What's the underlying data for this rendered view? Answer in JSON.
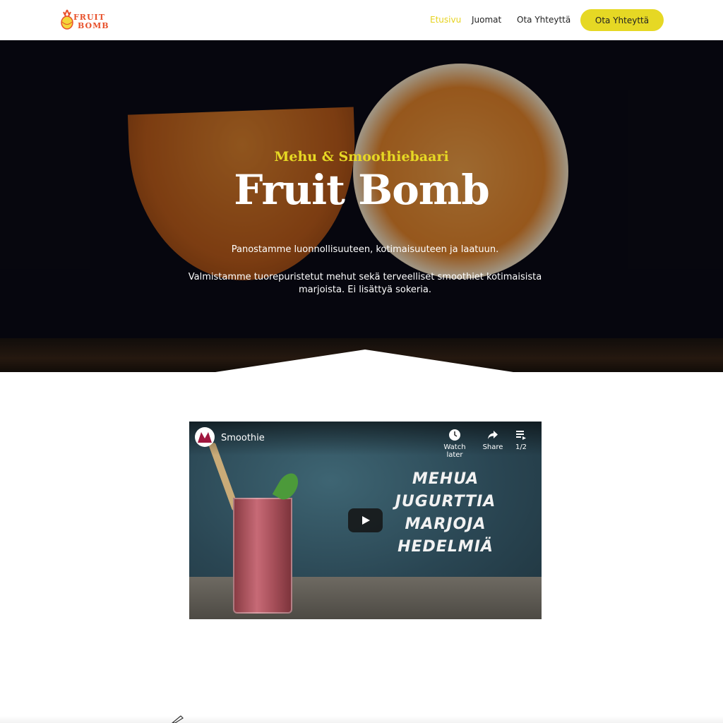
{
  "brand": {
    "line1": "FRUIT",
    "line2": "BOMB",
    "accent": "#e8502a"
  },
  "nav": {
    "items": [
      {
        "label": "Etusivu",
        "active": true
      },
      {
        "label": "Juomat",
        "active": false
      },
      {
        "label": "Ota Yhteyttä",
        "active": false
      }
    ],
    "cta_label": "Ota Yhteyttä"
  },
  "hero": {
    "subtitle": "Mehu & Smoothiebaari",
    "title": "Fruit Bomb",
    "paragraph1": "Panostamme luonnollisuuteen, kotimaisuuteen ja laatuun.",
    "paragraph2": "Valmistamme tuorepuristetut mehut sekä terveelliset smoothiet kotimaisista marjoista. Ei lisättyä sokeria."
  },
  "video": {
    "title": "Smoothie",
    "controls": {
      "watch_later": "Watch later",
      "share": "Share",
      "playlist": "1/2"
    },
    "overlay_words": [
      "MEHUA",
      "JUGURTTIA",
      "MARJOJA",
      "HEDELMIÄ"
    ]
  },
  "colors": {
    "accent_yellow": "#e6d824",
    "text_dark": "#222222"
  }
}
